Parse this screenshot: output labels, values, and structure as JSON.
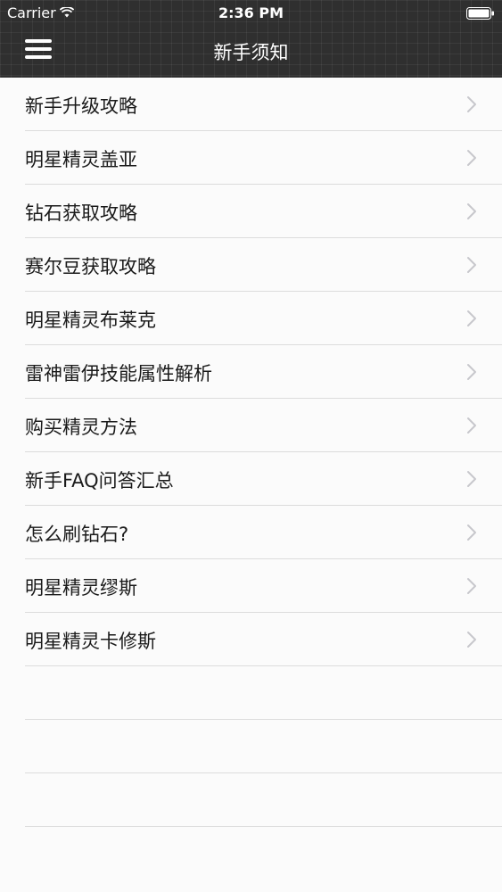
{
  "status_bar": {
    "carrier": "Carrier",
    "time": "2:36 PM",
    "wifi_icon": "wifi-icon",
    "battery_icon": "battery-icon"
  },
  "nav": {
    "title": "新手须知",
    "menu_icon": "hamburger-menu-icon",
    "bar_color": "#2f2f2f"
  },
  "list": {
    "items": [
      {
        "label": "新手升级攻略"
      },
      {
        "label": "明星精灵盖亚"
      },
      {
        "label": "钻石获取攻略"
      },
      {
        "label": "赛尔豆获取攻略"
      },
      {
        "label": "明星精灵布莱克"
      },
      {
        "label": "雷神雷伊技能属性解析"
      },
      {
        "label": "购买精灵方法"
      },
      {
        "label": "新手FAQ问答汇总"
      },
      {
        "label": "怎么刷钻石?"
      },
      {
        "label": "明星精灵缪斯"
      },
      {
        "label": "明星精灵卡修斯"
      }
    ],
    "chevron_icon": "chevron-right-icon"
  }
}
